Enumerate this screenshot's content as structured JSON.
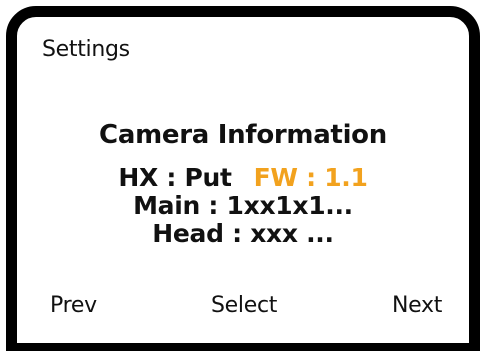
{
  "screen": {
    "title": "Settings",
    "heading": "Camera Information",
    "hx": "HX : Put",
    "fw": "FW : 1.1",
    "main": "Main : 1xx1x1...",
    "head": "Head : xxx ..."
  },
  "softkeys": {
    "prev": "Prev",
    "select": "Select",
    "next": "Next"
  },
  "colors": {
    "border": "#000000",
    "accent_fw": "#f2a21e",
    "text": "#111111",
    "background": "#ffffff"
  }
}
